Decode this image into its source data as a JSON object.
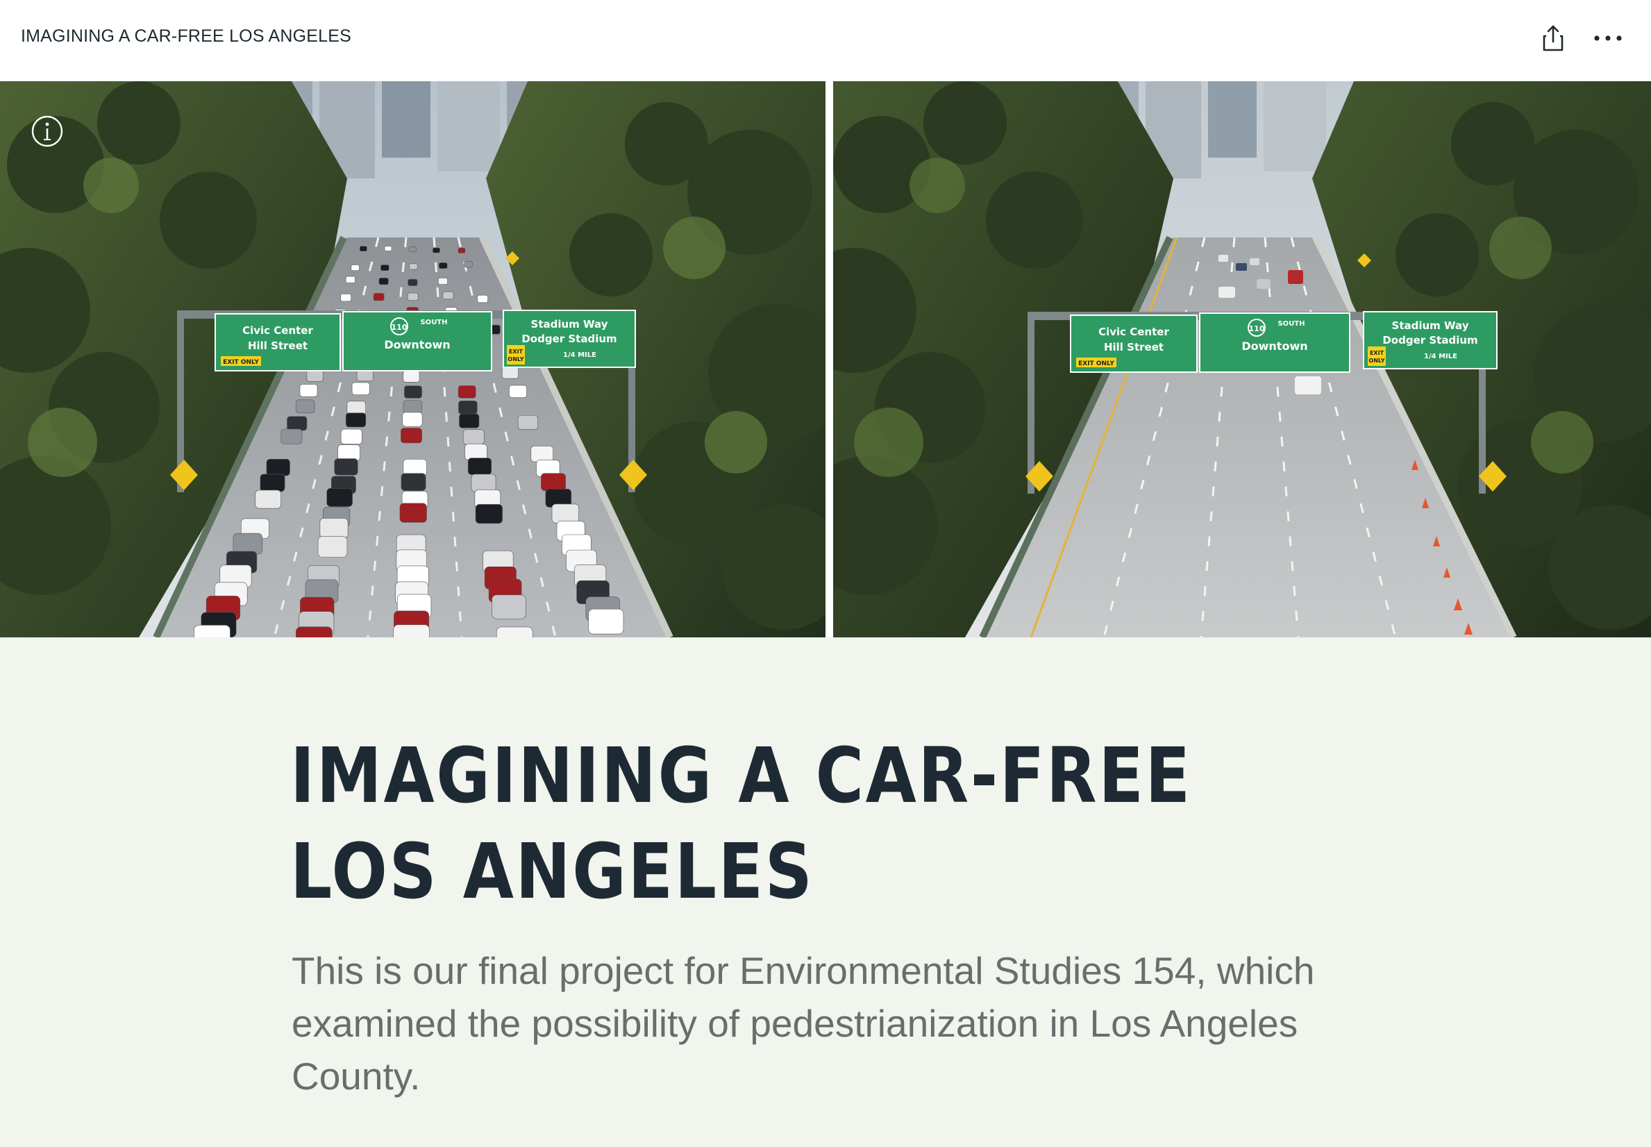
{
  "topbar": {
    "title": "IMAGINING A CAR-FREE LOS ANGELES",
    "share_icon": "share-icon",
    "more_icon": "more-horizontal-icon"
  },
  "hero": {
    "info_icon": "info-icon",
    "left_image": {
      "description": "freeway-110-traffic-jam",
      "signs": [
        "Civic Center",
        "Hill Street",
        "EXIT ONLY",
        "110",
        "SOUTH",
        "Downtown",
        "Stadium Way",
        "Dodger Stadium",
        "EXIT ONLY",
        "1/4 MILE"
      ]
    },
    "right_image": {
      "description": "freeway-110-empty",
      "signs": [
        "Civic Center",
        "Hill Street",
        "EXIT ONLY",
        "110",
        "SOUTH",
        "Downtown",
        "Stadium Way",
        "Dodger Stadium",
        "EXIT ONLY",
        "1/4 MILE"
      ]
    }
  },
  "main": {
    "headline": "IMAGINING A CAR-FREE LOS ANGELES",
    "subtitle": "This is our final project for Environmental Studies 154, which examined the possibility of pedestrianization in Los Angeles County."
  },
  "colors": {
    "page_background": "#f2f4ee",
    "headline": "#1e2a33",
    "subtitle": "#656f6e",
    "sign_green": "#2e9b63"
  }
}
